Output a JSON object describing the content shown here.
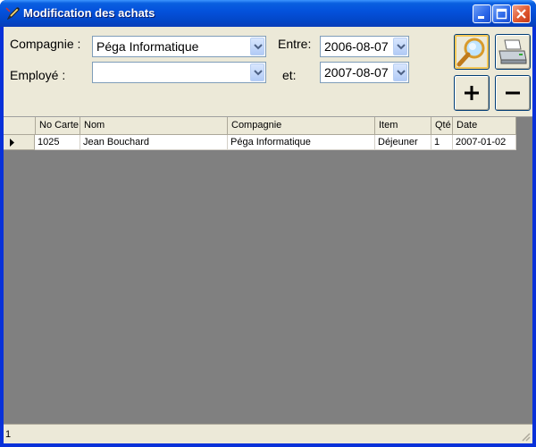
{
  "window": {
    "title": "Modification des achats",
    "icon": "pen-icon"
  },
  "filters": {
    "compagnie_label": "Compagnie :",
    "compagnie_value": "Péga Informatique",
    "employe_label": "Employé :",
    "employe_value": "",
    "entre_label": "Entre:",
    "entre_value": "2006-08-07",
    "et_label": "et:",
    "et_value": "2007-08-07"
  },
  "buttons": {
    "search_icon": "magnifier-icon",
    "print_icon": "printer-icon",
    "add_symbol": "+",
    "remove_symbol": "−"
  },
  "grid": {
    "columns": [
      "No Carte",
      "Nom",
      "Compagnie",
      "Item",
      "Qté",
      "Date"
    ],
    "rows": [
      [
        "1025",
        "Jean Bouchard",
        "Péga Informatique",
        "Déjeuner",
        "1",
        "2007-01-02"
      ]
    ]
  },
  "status": {
    "text": "1"
  }
}
